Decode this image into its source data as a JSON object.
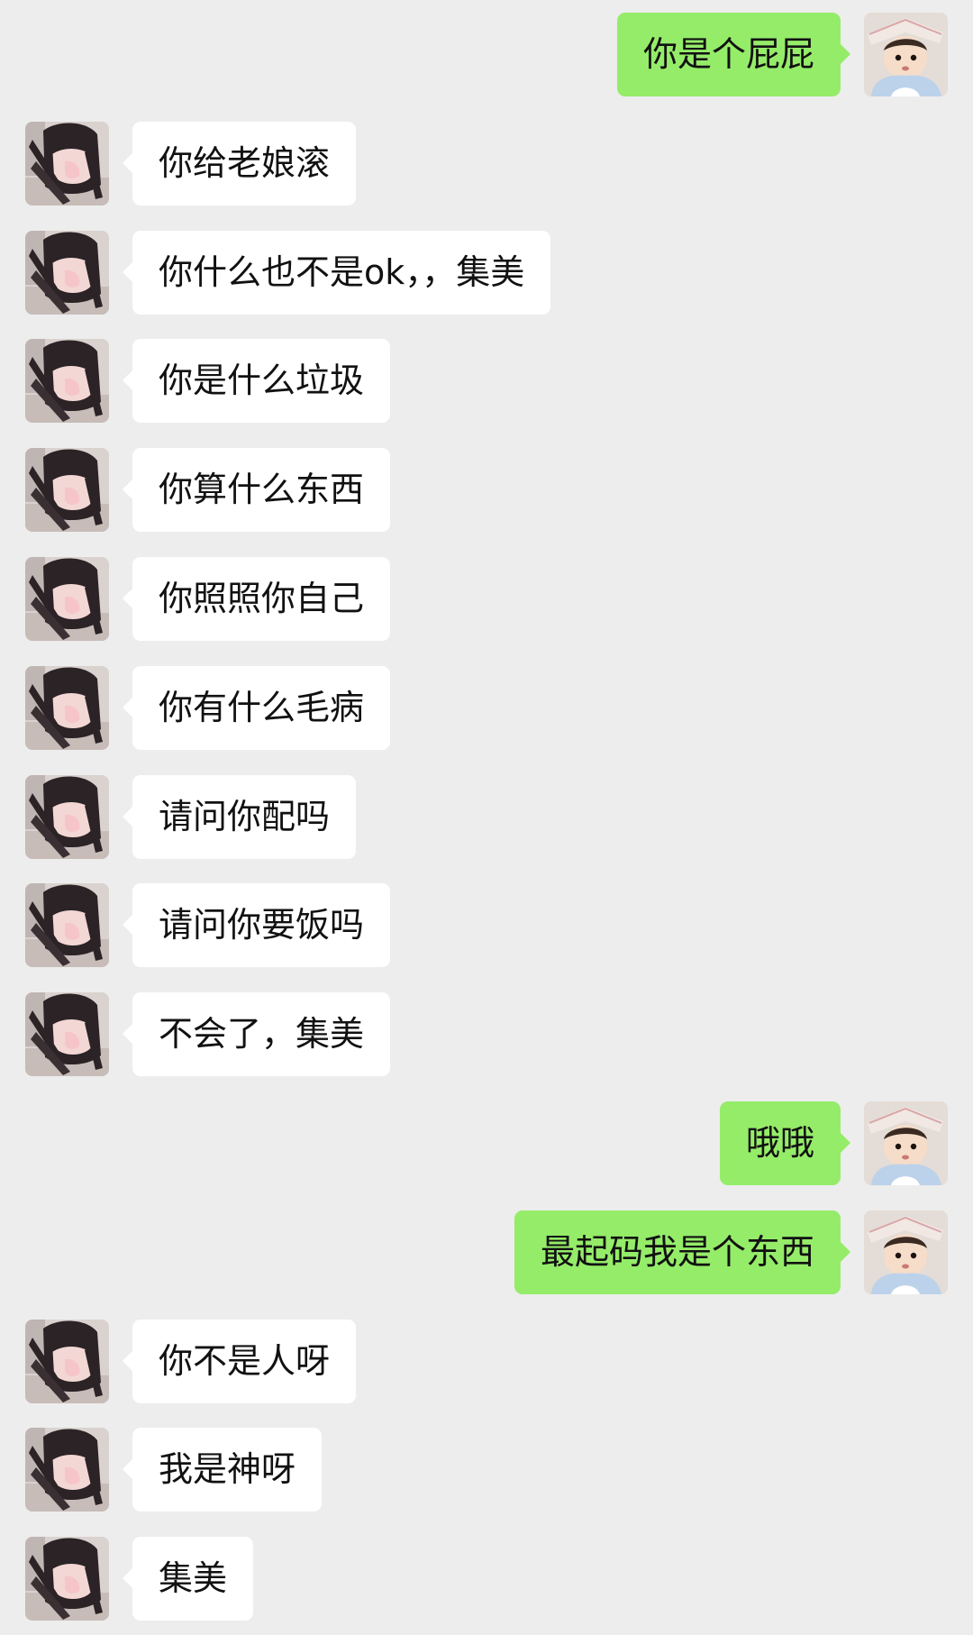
{
  "conversation": {
    "messages": [
      {
        "side": "right",
        "sender": "me",
        "avatar": "toddler-avatar",
        "text": "你是个屁屁"
      },
      {
        "side": "left",
        "sender": "contact",
        "avatar": "girl-avatar",
        "text": "你给老娘滚"
      },
      {
        "side": "left",
        "sender": "contact",
        "avatar": "girl-avatar",
        "text": "你什么也不是ok，，集美"
      },
      {
        "side": "left",
        "sender": "contact",
        "avatar": "girl-avatar",
        "text": "你是什么垃圾"
      },
      {
        "side": "left",
        "sender": "contact",
        "avatar": "girl-avatar",
        "text": "你算什么东西"
      },
      {
        "side": "left",
        "sender": "contact",
        "avatar": "girl-avatar",
        "text": "你照照你自己"
      },
      {
        "side": "left",
        "sender": "contact",
        "avatar": "girl-avatar",
        "text": "你有什么毛病"
      },
      {
        "side": "left",
        "sender": "contact",
        "avatar": "girl-avatar",
        "text": "请问你配吗"
      },
      {
        "side": "left",
        "sender": "contact",
        "avatar": "girl-avatar",
        "text": "请问你要饭吗"
      },
      {
        "side": "left",
        "sender": "contact",
        "avatar": "girl-avatar",
        "text": "不会了，集美"
      },
      {
        "side": "right",
        "sender": "me",
        "avatar": "toddler-avatar",
        "text": "哦哦"
      },
      {
        "side": "right",
        "sender": "me",
        "avatar": "toddler-avatar",
        "text": "最起码我是个东西"
      },
      {
        "side": "left",
        "sender": "contact",
        "avatar": "girl-avatar",
        "text": "你不是人呀"
      },
      {
        "side": "left",
        "sender": "contact",
        "avatar": "girl-avatar",
        "text": "我是神呀"
      },
      {
        "side": "left",
        "sender": "contact",
        "avatar": "girl-avatar",
        "text": "集美"
      }
    ]
  },
  "colors": {
    "background": "#ededed",
    "incoming_bubble": "#ffffff",
    "outgoing_bubble": "#95ec69",
    "text": "#111111"
  }
}
